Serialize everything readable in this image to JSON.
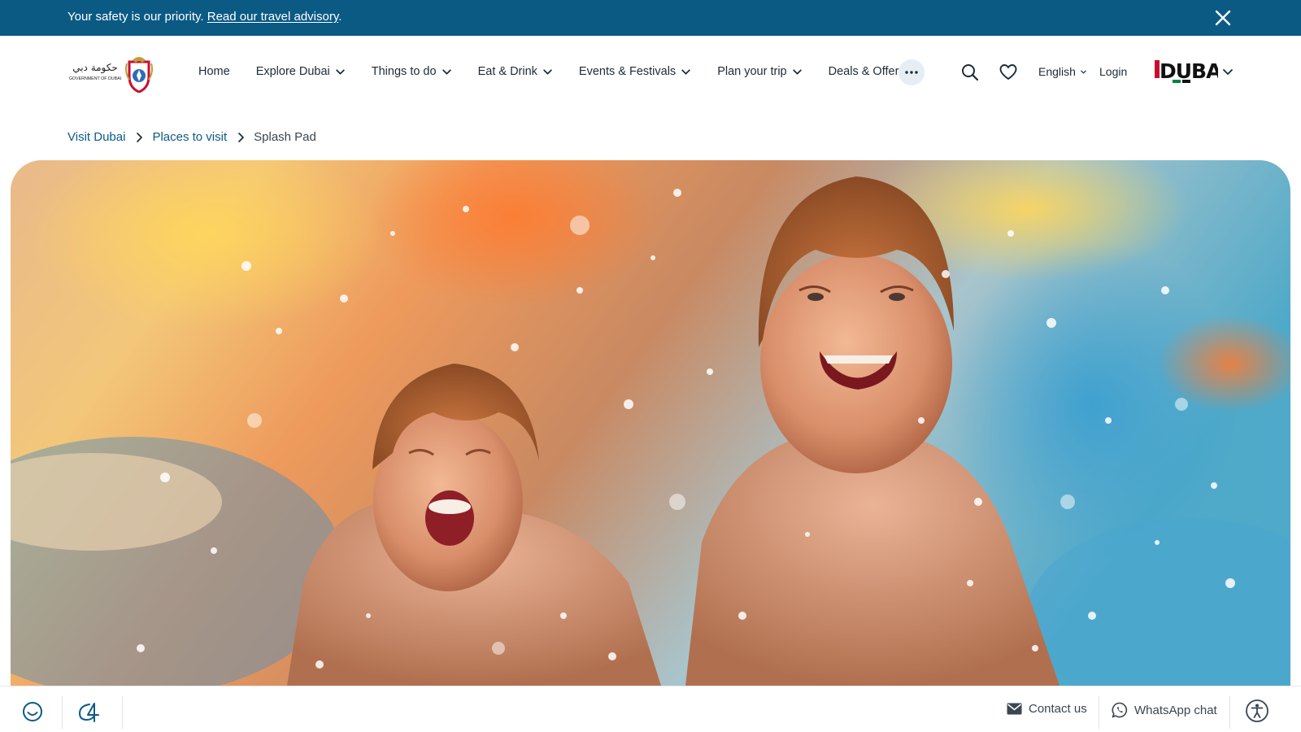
{
  "advisory": {
    "text": "Your safety is our priority.",
    "link_text": "Read our travel advisory",
    "suffix": "."
  },
  "header": {
    "gov_logo_arabic": "حكومة دبي",
    "gov_logo_english": "GOVERNMENT OF DUBAI",
    "nav": [
      {
        "label": "Home",
        "has_dropdown": false
      },
      {
        "label": "Explore Dubai",
        "has_dropdown": true
      },
      {
        "label": "Things to do",
        "has_dropdown": true
      },
      {
        "label": "Eat & Drink",
        "has_dropdown": true
      },
      {
        "label": "Events & Festivals",
        "has_dropdown": true
      },
      {
        "label": "Plan your trip",
        "has_dropdown": true
      },
      {
        "label": "Deals & Offers",
        "has_dropdown": true
      }
    ],
    "language": "English",
    "login": "Login",
    "brand_logo_text": "DUBAI"
  },
  "breadcrumb": {
    "items": [
      "Visit Dubai",
      "Places to visit"
    ],
    "current": "Splash Pad"
  },
  "hero": {
    "image_subject": "two laughing children splashing in water"
  },
  "bottom_bar": {
    "contact_label": "Contact us",
    "whatsapp_label": "WhatsApp chat"
  },
  "colors": {
    "advisory_bg": "#0b5a84",
    "link": "#0b5a84",
    "text": "#1d2b36",
    "more_button_bg": "#e6eef4",
    "brand_red": "#c8102e",
    "brand_green": "#00843d"
  },
  "icons": [
    "close-icon",
    "chevron-down-icon",
    "more-dots-icon",
    "search-icon",
    "heart-icon",
    "chevron-right-icon",
    "smiley-icon",
    "expo-logo-icon",
    "mail-icon",
    "whatsapp-icon",
    "accessibility-icon"
  ]
}
